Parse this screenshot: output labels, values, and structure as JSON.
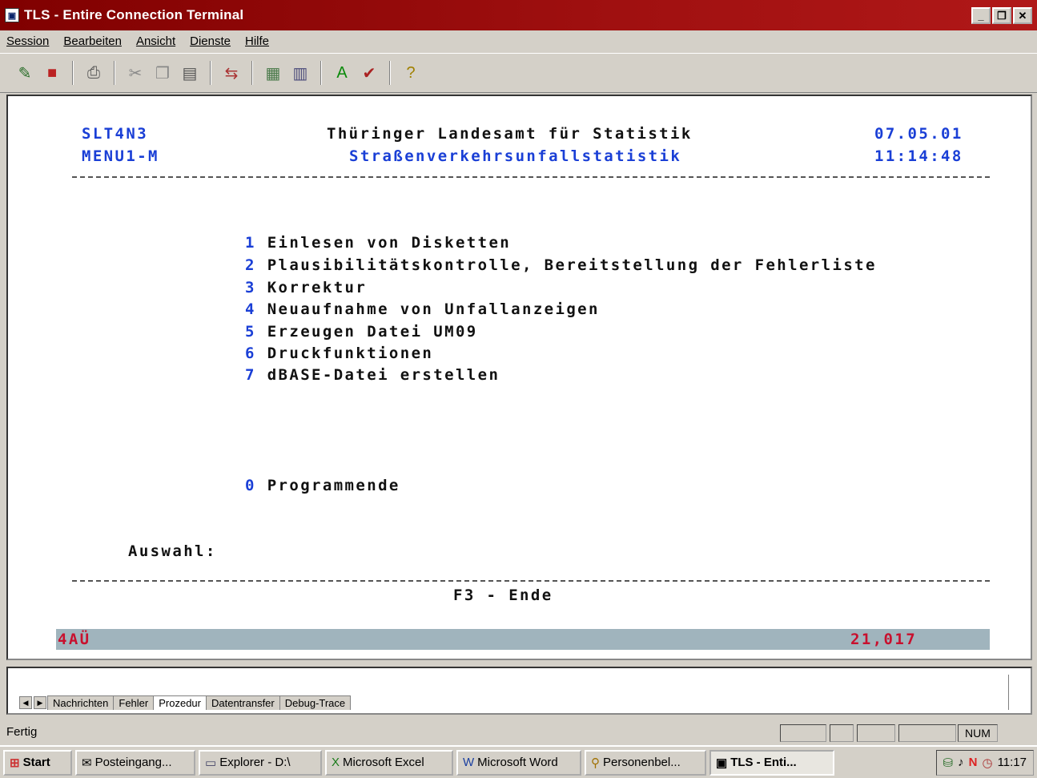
{
  "window": {
    "title": "TLS - Entire Connection Terminal"
  },
  "menu": [
    "Session",
    "Bearbeiten",
    "Ansicht",
    "Dienste",
    "Hilfe"
  ],
  "terminal": {
    "prog_id": "SLT4N3",
    "menu_id": "MENU1-M",
    "org": "Thüringer Landesamt für Statistik",
    "subtitle": "Straßenverkehrsunfallstatistik",
    "date": "07.05.01",
    "time": "11:14:48",
    "options": [
      {
        "key": "1",
        "label": "Einlesen von Disketten"
      },
      {
        "key": "2",
        "label": "Plausibilitätskontrolle, Bereitstellung der Fehlerliste"
      },
      {
        "key": "3",
        "label": "Korrektur"
      },
      {
        "key": "4",
        "label": "Neuaufnahme von Unfallanzeigen"
      },
      {
        "key": "5",
        "label": "Erzeugen Datei UM09"
      },
      {
        "key": "6",
        "label": "Druckfunktionen"
      },
      {
        "key": "7",
        "label": "dBASE-Datei erstellen"
      }
    ],
    "exit_key": "0",
    "exit_label": "Programmende",
    "prompt": "Auswahl:",
    "fkey": "F3 - Ende",
    "status_left": "4AÜ",
    "status_right": "21,017"
  },
  "tabs": [
    "Nachrichten",
    "Fehler",
    "Prozedur",
    "Datentransfer",
    "Debug-Trace"
  ],
  "statusbar": {
    "text": "Fertig",
    "num": "NUM"
  },
  "taskbar": {
    "start": "Start",
    "items": [
      "Posteingang...",
      "Explorer - D:\\",
      "Microsoft Excel",
      "Microsoft Word",
      "Personenbel...",
      "TLS - Enti..."
    ],
    "clock": "11:17"
  }
}
